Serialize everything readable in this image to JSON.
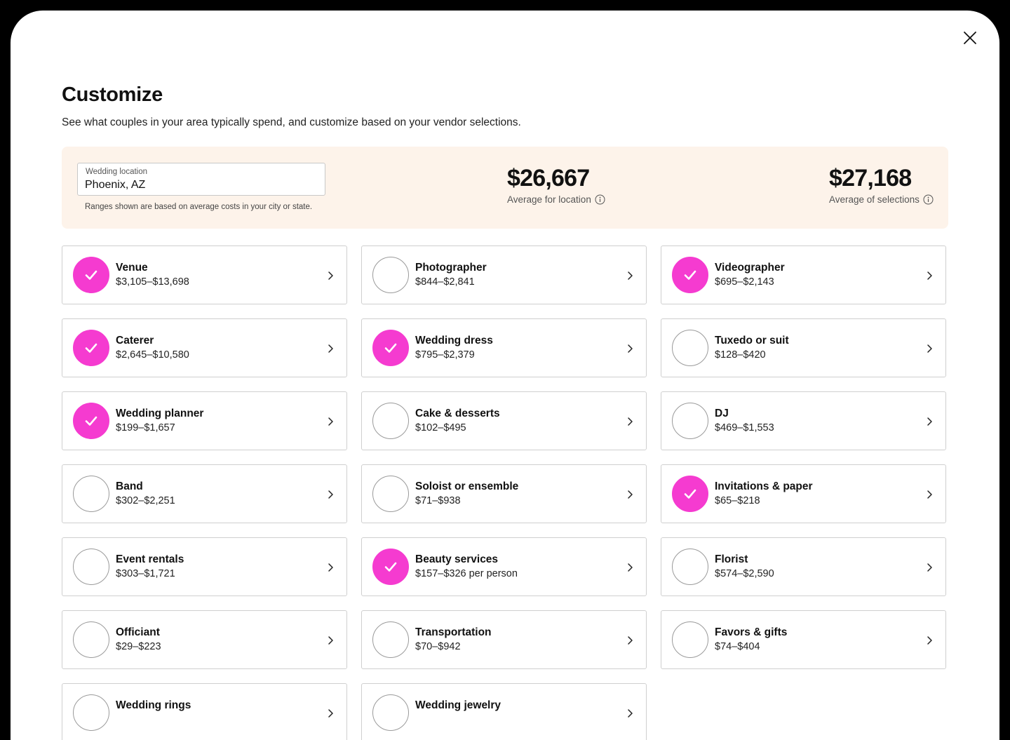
{
  "header": {
    "title": "Customize",
    "subtitle": "See what couples in your area typically spend, and customize based on your vendor selections."
  },
  "summary": {
    "location_label": "Wedding location",
    "location_value": "Phoenix, AZ",
    "location_note": "Ranges shown are based on average costs in your city or state.",
    "avg_location_value": "$26,667",
    "avg_location_label": "Average for location",
    "avg_selections_value": "$27,168",
    "avg_selections_label": "Average of selections"
  },
  "colors": {
    "accent": "#f53bd0",
    "summary_bg": "#fdf3ea"
  },
  "vendors": [
    {
      "name": "Venue",
      "range": "$3,105–$13,698",
      "selected": true
    },
    {
      "name": "Photographer",
      "range": "$844–$2,841",
      "selected": false
    },
    {
      "name": "Videographer",
      "range": "$695–$2,143",
      "selected": true
    },
    {
      "name": "Caterer",
      "range": "$2,645–$10,580",
      "selected": true
    },
    {
      "name": "Wedding dress",
      "range": "$795–$2,379",
      "selected": true
    },
    {
      "name": "Tuxedo or suit",
      "range": "$128–$420",
      "selected": false
    },
    {
      "name": "Wedding planner",
      "range": "$199–$1,657",
      "selected": true
    },
    {
      "name": "Cake & desserts",
      "range": "$102–$495",
      "selected": false
    },
    {
      "name": "DJ",
      "range": "$469–$1,553",
      "selected": false
    },
    {
      "name": "Band",
      "range": "$302–$2,251",
      "selected": false
    },
    {
      "name": "Soloist or ensemble",
      "range": "$71–$938",
      "selected": false
    },
    {
      "name": "Invitations & paper",
      "range": "$65–$218",
      "selected": true
    },
    {
      "name": "Event rentals",
      "range": "$303–$1,721",
      "selected": false
    },
    {
      "name": "Beauty services",
      "range": "$157–$326 per person",
      "selected": true
    },
    {
      "name": "Florist",
      "range": "$574–$2,590",
      "selected": false
    },
    {
      "name": "Officiant",
      "range": "$29–$223",
      "selected": false
    },
    {
      "name": "Transportation",
      "range": "$70–$942",
      "selected": false
    },
    {
      "name": "Favors & gifts",
      "range": "$74–$404",
      "selected": false
    },
    {
      "name": "Wedding rings",
      "range": "",
      "selected": false
    },
    {
      "name": "Wedding jewelry",
      "range": "",
      "selected": false
    }
  ]
}
